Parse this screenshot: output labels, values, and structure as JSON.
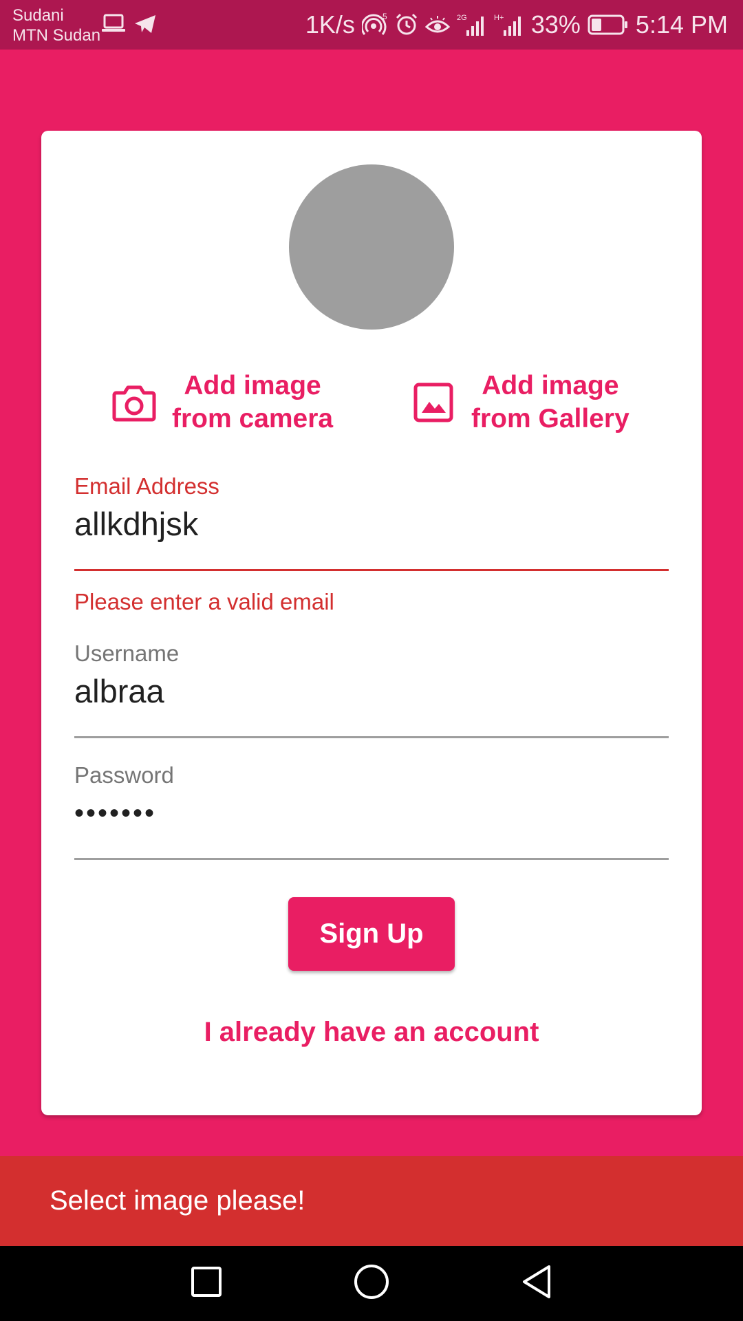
{
  "status_bar": {
    "carrier_line1": "Sudani",
    "carrier_line2": "MTN Sudan",
    "net_speed": "1K/s",
    "hotspot_count": "5",
    "net_type_1": "2G",
    "net_type_2": "H+",
    "battery_percent": "33%",
    "battery_level": 0.33,
    "time": "5:14 PM"
  },
  "signup": {
    "camera_button": {
      "line1": "Add image",
      "line2": "from camera"
    },
    "gallery_button": {
      "line1": "Add image",
      "line2": "from Gallery"
    },
    "email": {
      "label": "Email Address",
      "value": "allkdhjsk",
      "error": "Please enter a valid email"
    },
    "username": {
      "label": "Username",
      "value": "albraa"
    },
    "password": {
      "label": "Password",
      "value": "•••••••"
    },
    "submit_label": "Sign Up",
    "login_link": "I already have an account"
  },
  "snackbar": {
    "message": "Select image please!"
  },
  "colors": {
    "primary": "#E91E63",
    "status_bar": "#AD1750",
    "error": "#D32F2F",
    "avatar_placeholder": "#9E9E9E"
  },
  "icons": {
    "camera": "camera-icon",
    "gallery": "image-icon",
    "recents": "square-icon",
    "home": "circle-icon",
    "back": "triangle-back-icon"
  }
}
